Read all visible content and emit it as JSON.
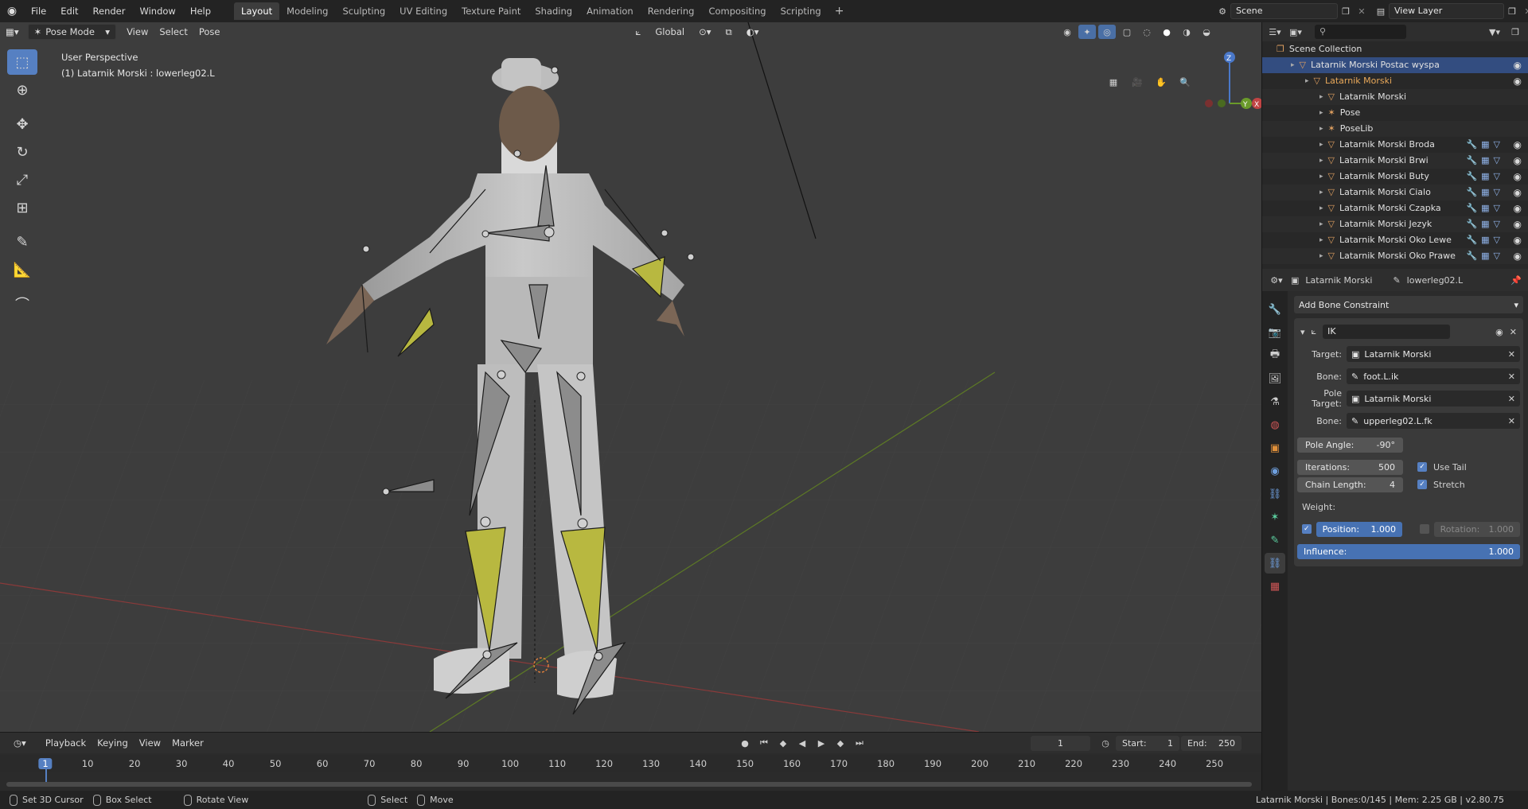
{
  "menu": [
    "File",
    "Edit",
    "Render",
    "Window",
    "Help"
  ],
  "workspaces": [
    "Layout",
    "Modeling",
    "Sculpting",
    "UV Editing",
    "Texture Paint",
    "Shading",
    "Animation",
    "Rendering",
    "Compositing",
    "Scripting"
  ],
  "active_workspace": "Layout",
  "scene": {
    "name": "Scene",
    "view_layer": "View Layer"
  },
  "viewport": {
    "mode": "Pose Mode",
    "menus": [
      "View",
      "Select",
      "Pose"
    ],
    "orientation": "Global",
    "info_line1": "User Perspective",
    "info_line2": "(1) Latarnik Morski : lowerleg02.L",
    "gizmo_axes": {
      "z": "Z",
      "x": "X",
      "y": "Y"
    }
  },
  "outliner": {
    "rows": [
      {
        "label": "Scene Collection",
        "indent": 0
      },
      {
        "label": "Latarnik Morski Postac wyspa",
        "indent": 1,
        "selected": true
      },
      {
        "label": "Latarnik Morski",
        "indent": 2,
        "orange": true
      },
      {
        "label": "Latarnik Morski",
        "indent": 3
      },
      {
        "label": "Pose",
        "indent": 3
      },
      {
        "label": "PoseLib",
        "indent": 3
      },
      {
        "label": "Latarnik Morski Broda",
        "indent": 3
      },
      {
        "label": "Latarnik Morski Brwi",
        "indent": 3
      },
      {
        "label": "Latarnik Morski Buty",
        "indent": 3
      },
      {
        "label": "Latarnik Morski Cialo",
        "indent": 3
      },
      {
        "label": "Latarnik Morski Czapka",
        "indent": 3
      },
      {
        "label": "Latarnik Morski Jezyk",
        "indent": 3
      },
      {
        "label": "Latarnik Morski Oko Lewe",
        "indent": 3
      },
      {
        "label": "Latarnik Morski Oko Prawe",
        "indent": 3
      }
    ]
  },
  "properties": {
    "object": "Latarnik Morski",
    "bone": "lowerleg02.L",
    "add_constraint": "Add Bone Constraint",
    "constraint_name": "IK",
    "target_label": "Target:",
    "target": "Latarnik Morski",
    "bone_label": "Bone:",
    "bone_value": "foot.L.ik",
    "pole_target_label": "Pole Target:",
    "pole_target": "Latarnik Morski",
    "pole_bone_label": "Bone:",
    "pole_bone": "upperleg02.L.fk",
    "pole_angle_label": "Pole Angle:",
    "pole_angle": "-90°",
    "iterations_label": "Iterations:",
    "iterations": "500",
    "chain_length_label": "Chain Length:",
    "chain_length": "4",
    "use_tail": "Use Tail",
    "stretch": "Stretch",
    "weight_label": "Weight:",
    "position_label": "Position:",
    "position": "1.000",
    "rotation_label": "Rotation:",
    "rotation": "1.000",
    "influence_label": "Influence:",
    "influence": "1.000"
  },
  "timeline": {
    "menus": [
      "Playback",
      "Keying",
      "View",
      "Marker"
    ],
    "current_frame": "1",
    "start_label": "Start:",
    "start": "1",
    "end_label": "End:",
    "end": "250",
    "ruler": [
      "1",
      "10",
      "20",
      "30",
      "40",
      "50",
      "60",
      "70",
      "80",
      "90",
      "100",
      "110",
      "120",
      "130",
      "140",
      "150",
      "160",
      "170",
      "180",
      "190",
      "200",
      "210",
      "220",
      "230",
      "240",
      "250"
    ]
  },
  "status": {
    "left": [
      "Set 3D Cursor",
      "Box Select",
      "Rotate View",
      "Select",
      "Move"
    ],
    "right": "Latarnik Morski | Bones:0/145 | Mem: 2.25 GB | v2.80.75"
  },
  "colors": {
    "accent": "#5680c2",
    "bone_selected": "#b8b840",
    "axis_x": "#b34747",
    "axis_y": "#7a9a30"
  }
}
